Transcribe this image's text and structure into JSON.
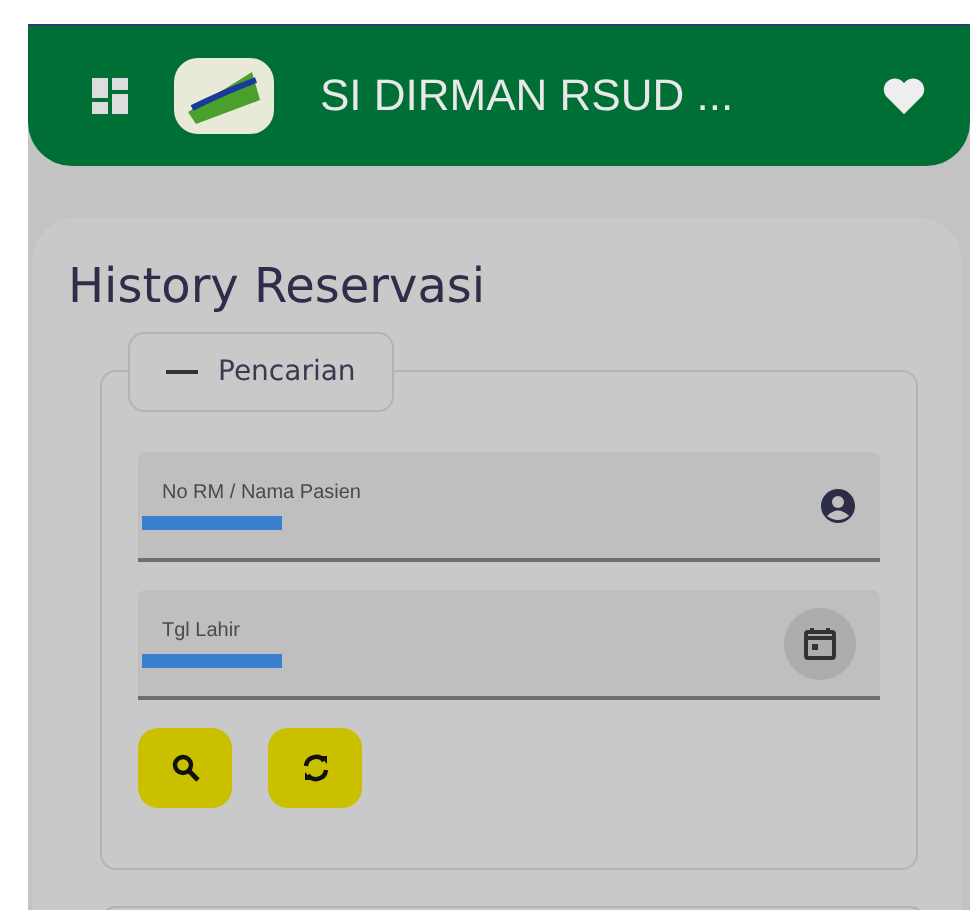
{
  "header": {
    "title": "SI DIRMAN RSUD ..."
  },
  "page": {
    "title": "History Reservasi"
  },
  "search_panel": {
    "legend": "Pencarian",
    "expanded": true,
    "fields": [
      {
        "kind": "text",
        "label": "No RM / Nama Pasien",
        "redacted": true
      },
      {
        "kind": "date",
        "label": "Tgl Lahir",
        "redacted": true
      }
    ]
  }
}
